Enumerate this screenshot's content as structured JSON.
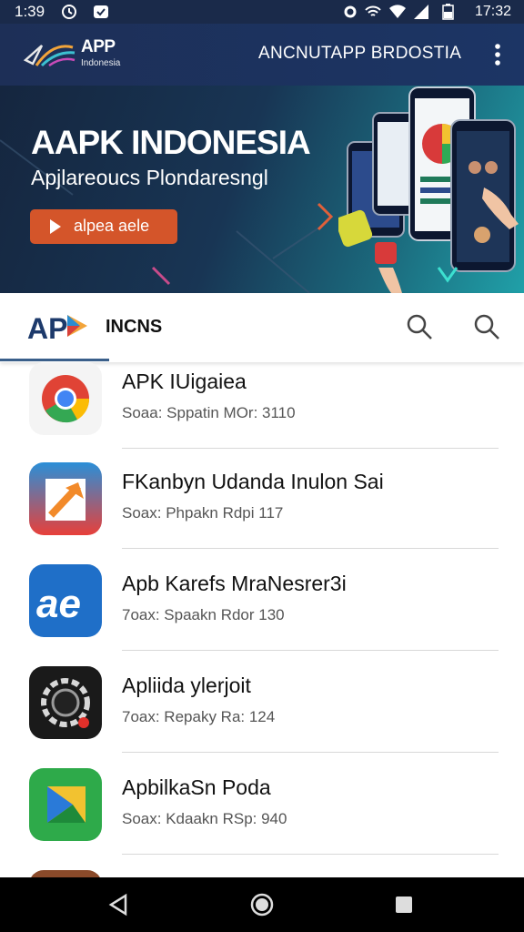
{
  "status_bar": {
    "time_left": "1:39",
    "time_right": "17:32"
  },
  "app_bar": {
    "logo_text": "APP",
    "logo_sub": "Indonesia",
    "title": "ANCNUTAPP BRDOSTIA"
  },
  "banner": {
    "title": "AAPK INDONESIA",
    "subtitle": "Apjlareoucs Plondaresngl",
    "cta_label": "alpea aele"
  },
  "tab_bar": {
    "label": "INCNS"
  },
  "apps": [
    {
      "title": "APK IUigaiea",
      "meta": "Soaa: Sppatin MOr: 3110",
      "icon": "chrome-icon"
    },
    {
      "title": "FKanbyn Udanda Inulon Sai",
      "meta": "Soax: Phpakn Rdpi 117",
      "icon": "arrow-app-icon"
    },
    {
      "title": "Apb Karefs MraNesrer3i",
      "meta": "7oax: Spaakn Rdor 130",
      "icon": "ae-app-icon"
    },
    {
      "title": "Apliida ylerjoit",
      "meta": "7oax: Repaky Ra: 124",
      "icon": "camera-app-icon"
    },
    {
      "title": "ApbilkaSn Poda",
      "meta": "Soax: Kdaakn RSp: 940",
      "icon": "play-app-icon"
    }
  ],
  "colors": {
    "app_bar": "#1d2f57",
    "cta": "#d4552a",
    "accent": "#3a5f8a"
  }
}
